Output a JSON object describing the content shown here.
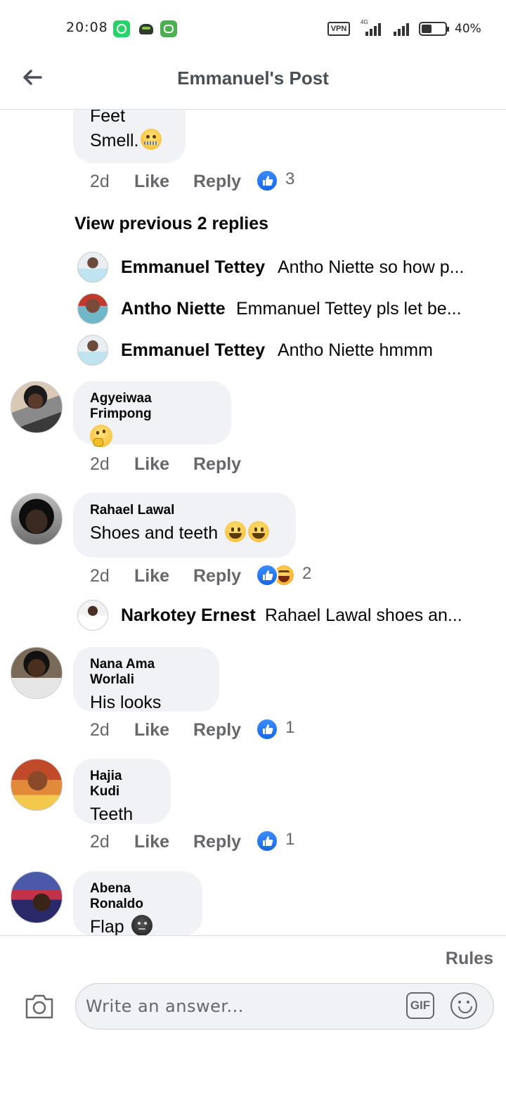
{
  "status_bar": {
    "time": "20:08",
    "vpn": "VPN",
    "network": "4G",
    "battery": "40%",
    "apps": [
      "whatsapp-icon",
      "owl-app-icon",
      "robot-app-icon"
    ]
  },
  "header": {
    "title": "Emmanuel's Post",
    "back_icon": "arrow-left-icon"
  },
  "comments": [
    {
      "text_lines": [
        "Feet",
        "Smell."
      ],
      "emoji": "zipper-mouth-face",
      "time": "2d",
      "like_label": "Like",
      "reply_label": "Reply",
      "reactions": [
        "like"
      ],
      "reaction_count": "3"
    },
    {
      "author": "Agyeiwaa Frimpong",
      "text": "",
      "emoji": "thinking-face",
      "time": "2d",
      "like_label": "Like",
      "reply_label": "Reply"
    },
    {
      "author": "Rahael Lawal",
      "text": "Shoes and teeth",
      "emoji": "grinning-face x2",
      "time": "2d",
      "like_label": "Like",
      "reply_label": "Reply",
      "reactions": [
        "like",
        "haha"
      ],
      "reaction_count": "2"
    },
    {
      "author": "Nana Ama Worlali",
      "text": "His looks",
      "time": "2d",
      "like_label": "Like",
      "reply_label": "Reply",
      "reactions": [
        "like"
      ],
      "reaction_count": "1"
    },
    {
      "author": "Hajia Kudi",
      "text": "Teeth",
      "time": "2d",
      "like_label": "Like",
      "reply_label": "Reply",
      "reactions": [
        "like"
      ],
      "reaction_count": "1"
    },
    {
      "author": "Abena Ronaldo",
      "text": "Flap",
      "emoji": "dark-face"
    }
  ],
  "view_previous": "View previous 2 replies",
  "replies": [
    {
      "name": "Emmanuel Tettey",
      "text": "Antho Niette so how p..."
    },
    {
      "name": "Antho Niette",
      "text": "Emmanuel Tettey pls let be..."
    },
    {
      "name": "Emmanuel Tettey",
      "text": "Antho Niette hmmm"
    },
    {
      "name": "Narkotey Ernest",
      "text": "Rahael Lawal shoes an..."
    }
  ],
  "composer": {
    "rules": "Rules",
    "placeholder": "Write an answer...",
    "gif": "GIF"
  },
  "colors": {
    "bubble": "#f0f2f5",
    "secondary_text": "#65676b",
    "like_blue": "#1877f2"
  }
}
